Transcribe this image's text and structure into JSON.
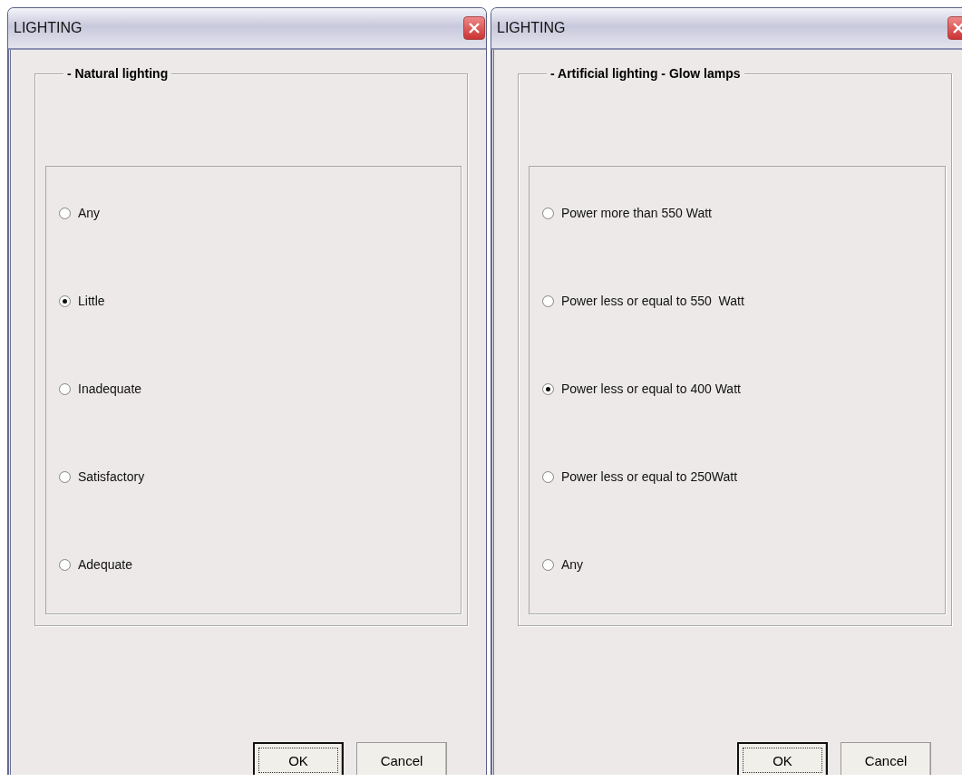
{
  "dialogs": [
    {
      "title": "LIGHTING",
      "group": {
        "legend": "- Natural lighting",
        "options": [
          {
            "label": "Any",
            "selected": false
          },
          {
            "label": "Little",
            "selected": true
          },
          {
            "label": "Inadequate",
            "selected": false
          },
          {
            "label": "Satisfactory",
            "selected": false
          },
          {
            "label": "Adequate",
            "selected": false
          }
        ]
      },
      "buttons": [
        {
          "label": "OK",
          "default": true
        },
        {
          "label": "Cancel",
          "default": false
        }
      ]
    },
    {
      "title": "LIGHTING",
      "group": {
        "legend": "- Artificial lighting - Glow lamps",
        "options": [
          {
            "label": "Power more than 550 Watt",
            "selected": false
          },
          {
            "label": "Power less or equal to 550  Watt",
            "selected": false
          },
          {
            "label": "Power less or equal to 400 Watt",
            "selected": true
          },
          {
            "label": "Power less or equal to 250Watt",
            "selected": false
          },
          {
            "label": "Any",
            "selected": false
          }
        ]
      },
      "buttons": [
        {
          "label": "OK",
          "default": true
        },
        {
          "label": "Cancel",
          "default": false
        }
      ]
    }
  ]
}
